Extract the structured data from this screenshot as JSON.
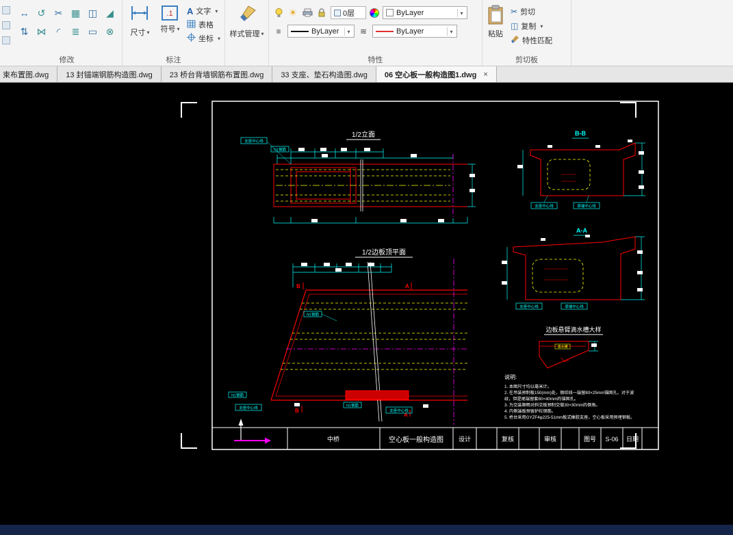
{
  "ribbon": {
    "icon_glyphs": {
      "sun": "☀",
      "linetype_list": "≡",
      "lineweight": "≋",
      "cut": "✂",
      "copy": "◫",
      "symbol": ".1",
      "text": "A"
    },
    "panels": {
      "modify": {
        "label": "修改",
        "icons": [
          {
            "name": "move",
            "glyph": "↔"
          },
          {
            "name": "rotate",
            "glyph": "↺"
          },
          {
            "name": "trim",
            "glyph": "✂"
          },
          {
            "name": "array",
            "glyph": "▦"
          },
          {
            "name": "copy",
            "glyph": "◫"
          },
          {
            "name": "chamfer",
            "glyph": "◢"
          },
          {
            "name": "stretch",
            "glyph": "⇅"
          },
          {
            "name": "mirror",
            "glyph": "⋈"
          },
          {
            "name": "fillet",
            "glyph": "◜"
          },
          {
            "name": "offset",
            "glyph": "≣"
          },
          {
            "name": "rectangle",
            "glyph": "▭"
          },
          {
            "name": "explode",
            "glyph": "⊗"
          }
        ]
      },
      "annotation": {
        "label": "标注",
        "items": {
          "dimension": "尺寸",
          "symbol": "符号",
          "text": "文字",
          "table": "表格",
          "coordinate": "坐标"
        }
      },
      "style": {
        "label": "样式管理"
      },
      "properties": {
        "label": "特性",
        "layer_value": "0层",
        "color_value": "ByLayer",
        "linetype_value": "ByLayer",
        "linewidth_value": "ByLayer"
      },
      "clipboard": {
        "label": "剪切板",
        "paste": "粘贴",
        "cut": "剪切",
        "copy": "复制",
        "match_properties": "特性匹配"
      }
    }
  },
  "tabbar": {
    "close_glyph": "×",
    "tabs": [
      {
        "label": "束布置图.dwg",
        "active": false
      },
      {
        "label": "13 封锚端钢筋构造图.dwg",
        "active": false
      },
      {
        "label": "23 桥台背墙钢筋布置图.dwg",
        "active": false
      },
      {
        "label": "33 支座、垫石构造图.dwg",
        "active": false
      },
      {
        "label": "06 空心板一般构造图1.dwg",
        "active": true
      }
    ]
  },
  "drawing": {
    "titles": {
      "elevation": "1/2立面",
      "plan": "1/2边板顶平面",
      "section_bb": "B-B",
      "section_aa": "A-A",
      "detail": "边板悬臂滴水槽大样"
    },
    "labels": {
      "bearing_centerline": "支座中心线",
      "beam_end_centerline": "梁端中心线",
      "rebar": "N1钢筋",
      "drip_groove": "滴水槽",
      "marker_a": "A",
      "marker_b": "B"
    },
    "notes": {
      "title": "说明:",
      "lines": [
        "1. 本图尺寸均以毫米计。",
        "2. 在吊装预制板150(mm)处，钢绞线一端留80×25mm锚固孔，对于波",
        "   纹，但是尾端留套80×40mm的锚固孔。",
        "3. 为交装顺畅对斜交板预制交做30×30mm的倒角。",
        "4. 内侧端板预留护栏钢筋。",
        "5. 桥台采用GYZF4φ225-51mm板式橡胶支座，空心板采用预埋钢板。"
      ]
    },
    "titleblock": {
      "bridge_name": "中桥",
      "drawing_title": "空心板一般构造图",
      "design": "设计",
      "check": "复核",
      "review": "审核",
      "drawing_no_label": "图号",
      "drawing_no": "S-06",
      "date": "日期"
    }
  },
  "colors": {
    "cad_red": "#ff0000",
    "cad_yellow": "#ffff00",
    "cad_cyan": "#00ffff",
    "cad_magenta": "#ff00ff",
    "canvas_bg": "#000000",
    "taskbar": "#152449"
  }
}
